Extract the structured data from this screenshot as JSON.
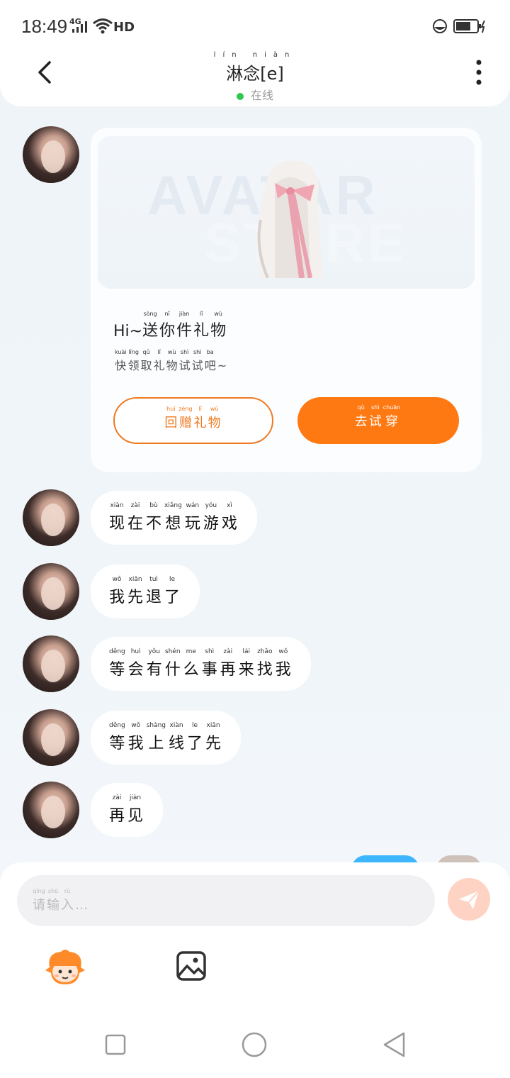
{
  "status_bar": {
    "time": "18:49",
    "network": "4G",
    "hd": "HD"
  },
  "header": {
    "title_pinyin": "lín niàn",
    "title": "淋念[e]",
    "status_pinyin": "zài xiàn",
    "status": "在线"
  },
  "card": {
    "banner_text_1": "AVATAR",
    "banner_text_2": "STORE",
    "title_prefix": "Hi~",
    "title_chars": [
      {
        "py": "sòng",
        "ch": "送"
      },
      {
        "py": "nǐ",
        "ch": "你"
      },
      {
        "py": "jiàn",
        "ch": "件"
      },
      {
        "py": "lǐ",
        "ch": "礼"
      },
      {
        "py": "wù",
        "ch": "物"
      }
    ],
    "subtitle_chars": [
      {
        "py": "kuài",
        "ch": "快"
      },
      {
        "py": "lǐng",
        "ch": "领"
      },
      {
        "py": "qǔ",
        "ch": "取"
      },
      {
        "py": "lǐ",
        "ch": "礼"
      },
      {
        "py": "wù",
        "ch": "物"
      },
      {
        "py": "shì",
        "ch": "试"
      },
      {
        "py": "shì",
        "ch": "试"
      },
      {
        "py": "ba",
        "ch": "吧"
      },
      {
        "py": "",
        "ch": "~"
      }
    ],
    "return_gift_chars": [
      {
        "py": "huí",
        "ch": "回"
      },
      {
        "py": "zèng",
        "ch": "赠"
      },
      {
        "py": "lǐ",
        "ch": "礼"
      },
      {
        "py": "wù",
        "ch": "物"
      }
    ],
    "try_on_chars": [
      {
        "py": "qù",
        "ch": "去"
      },
      {
        "py": "shì",
        "ch": "试"
      },
      {
        "py": "chuān",
        "ch": "穿"
      }
    ]
  },
  "messages": [
    {
      "chars": [
        {
          "py": "xiàn",
          "ch": "现"
        },
        {
          "py": "zài",
          "ch": "在"
        },
        {
          "py": "bù",
          "ch": "不"
        },
        {
          "py": "xiǎng",
          "ch": "想"
        },
        {
          "py": "wán",
          "ch": "玩"
        },
        {
          "py": "yóu",
          "ch": "游"
        },
        {
          "py": "xì",
          "ch": "戏"
        }
      ]
    },
    {
      "chars": [
        {
          "py": "wǒ",
          "ch": "我"
        },
        {
          "py": "xiān",
          "ch": "先"
        },
        {
          "py": "tuì",
          "ch": "退"
        },
        {
          "py": "le",
          "ch": "了"
        }
      ]
    },
    {
      "chars": [
        {
          "py": "děng",
          "ch": "等"
        },
        {
          "py": "huì",
          "ch": "会"
        },
        {
          "py": "yǒu",
          "ch": "有"
        },
        {
          "py": "shén",
          "ch": "什"
        },
        {
          "py": "me",
          "ch": "么"
        },
        {
          "py": "shì",
          "ch": "事"
        },
        {
          "py": "zài",
          "ch": "再"
        },
        {
          "py": "lái",
          "ch": "来"
        },
        {
          "py": "zhǎo",
          "ch": "找"
        },
        {
          "py": "wǒ",
          "ch": "我"
        }
      ]
    },
    {
      "chars": [
        {
          "py": "děng",
          "ch": "等"
        },
        {
          "py": "wǒ",
          "ch": "我"
        },
        {
          "py": "shàng",
          "ch": "上"
        },
        {
          "py": "xiàn",
          "ch": "线"
        },
        {
          "py": "le",
          "ch": "了"
        },
        {
          "py": "xiān",
          "ch": "先"
        }
      ]
    },
    {
      "chars": [
        {
          "py": "zài",
          "ch": "再"
        },
        {
          "py": "jiàn",
          "ch": "见"
        }
      ]
    }
  ],
  "input": {
    "placeholder_chars": [
      {
        "py": "qǐng",
        "ch": "请"
      },
      {
        "py": "shū",
        "ch": "输"
      },
      {
        "py": "rù",
        "ch": "入"
      },
      {
        "py": "",
        "ch": "…"
      }
    ]
  },
  "icons": [
    "back-icon",
    "more-icon",
    "send-icon",
    "mascot-icon",
    "image-icon",
    "nav-recent-icon",
    "nav-home-icon",
    "nav-back-icon"
  ],
  "colors": {
    "accent": "#ff7913",
    "online": "#2ec74f",
    "peek_bubble": "#3db6ff"
  }
}
